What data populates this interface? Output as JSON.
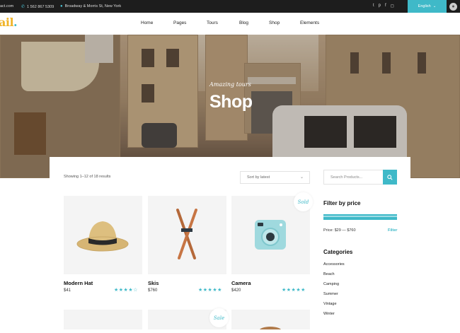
{
  "topbar": {
    "email": "act.com",
    "phone": "1 562 867 5309",
    "address": "Broadway & Morris St, New York",
    "language": "English"
  },
  "logo": {
    "text": "ail",
    "dot": "."
  },
  "nav": [
    "Home",
    "Pages",
    "Tours",
    "Blog",
    "Shop",
    "Elements"
  ],
  "hero": {
    "script": "Amazing tours",
    "title": "Shop"
  },
  "shop": {
    "results": "Showing 1–12 of 18 results",
    "sort": "Sort by latest",
    "products": [
      {
        "name": "Modern Hat",
        "price": "$41",
        "stars": "★★★★☆",
        "badge": ""
      },
      {
        "name": "Skis",
        "price": "$760",
        "stars": "★★★★★",
        "badge": ""
      },
      {
        "name": "Camera",
        "price": "$420",
        "stars": "★★★★★",
        "badge": "Sold"
      }
    ],
    "second_row_badge": "Sale"
  },
  "sidebar": {
    "search_placeholder": "Search Products...",
    "filter_title": "Filter by price",
    "price_range": "Price: $29 — $760",
    "filter_link": "Filter",
    "categories_title": "Categories",
    "categories": [
      "Accessories",
      "Beach",
      "Camping",
      "Summer",
      "Vintage",
      "Winter"
    ]
  },
  "colors": {
    "accent": "#3fb9c8",
    "logo": "#f0b429",
    "topbar": "#1d1d1d"
  }
}
